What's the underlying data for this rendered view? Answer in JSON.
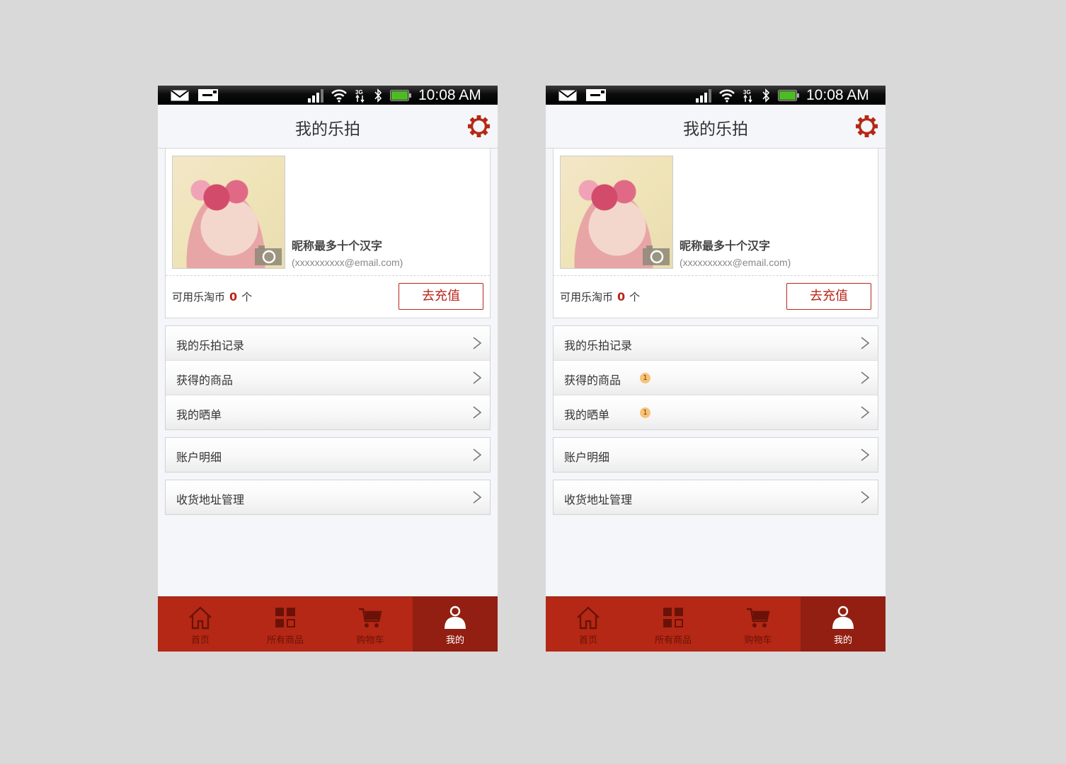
{
  "colors": {
    "accent": "#b52815",
    "accent_dark": "#921f11",
    "badge": "#f7c27a",
    "background": "#f5f6fa"
  },
  "screens": [
    {
      "status": {
        "time": "10:08 AM"
      },
      "header": {
        "title": "我的乐拍",
        "settings_icon": "gear-icon"
      },
      "profile": {
        "nickname": "昵称最多十个汉字",
        "email": "(xxxxxxxxxx@email.com)",
        "coins_label": "可用乐淘币",
        "coins_value": "0",
        "coins_unit": "个",
        "recharge_label": "去充值"
      },
      "menu": {
        "record": "我的乐拍记录",
        "goods": "获得的商品",
        "show": "我的晒单",
        "account": "账户明细",
        "address": "收货地址管理"
      },
      "tabs": {
        "home": "首页",
        "all": "所有商品",
        "cart": "购物车",
        "mine": "我的"
      }
    },
    {
      "status": {
        "time": "10:08 AM"
      },
      "header": {
        "title": "我的乐拍",
        "settings_icon": "gear-icon"
      },
      "profile": {
        "nickname": "昵称最多十个汉字",
        "email": "(xxxxxxxxxx@email.com)",
        "coins_label": "可用乐淘币",
        "coins_value": "0",
        "coins_unit": "个",
        "recharge_label": "去充值"
      },
      "menu": {
        "record": "我的乐拍记录",
        "goods": "获得的商品",
        "goods_badge": "1",
        "show": "我的晒单",
        "show_badge": "1",
        "account": "账户明细",
        "address": "收货地址管理"
      },
      "tabs": {
        "home": "首页",
        "all": "所有商品",
        "cart": "购物车",
        "mine": "我的"
      }
    }
  ]
}
